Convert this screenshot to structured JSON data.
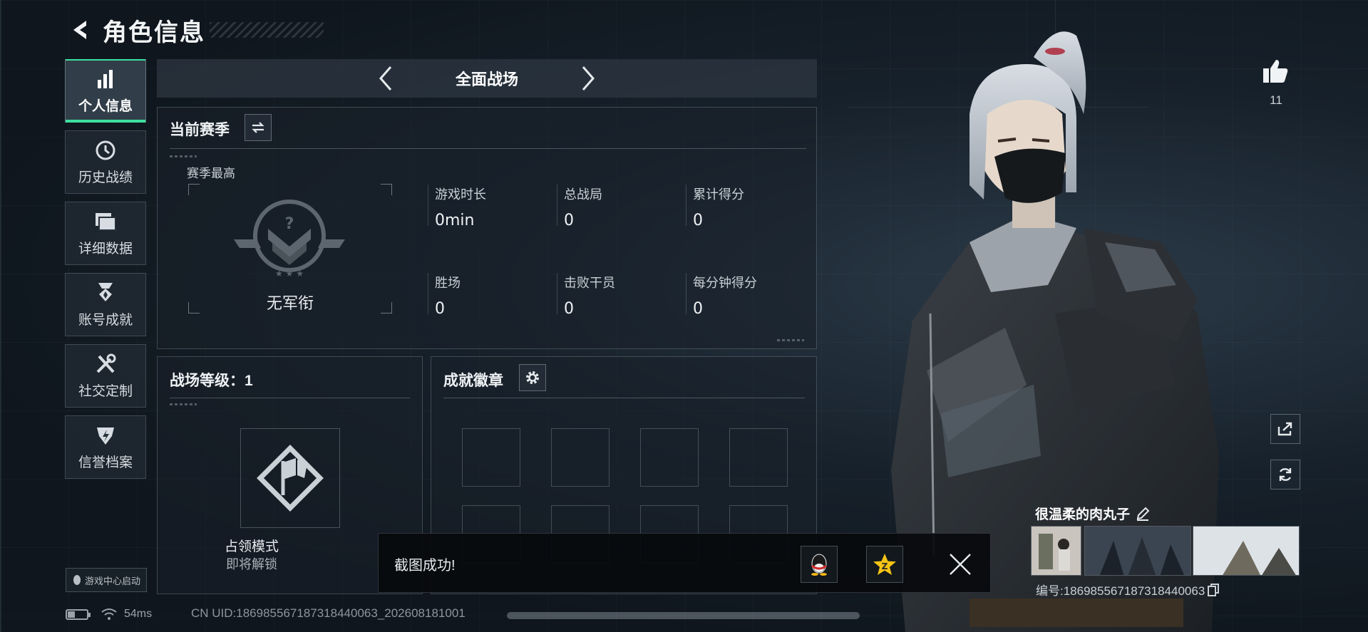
{
  "header": {
    "title": "角色信息"
  },
  "sidebar": {
    "items": [
      {
        "label": "个人信息",
        "icon": "bar-chart-icon"
      },
      {
        "label": "历史战绩",
        "icon": "clock-icon"
      },
      {
        "label": "详细数据",
        "icon": "folder-icon"
      },
      {
        "label": "账号成就",
        "icon": "medal-icon"
      },
      {
        "label": "社交定制",
        "icon": "tools-icon"
      },
      {
        "label": "信誉档案",
        "icon": "shield-icon"
      }
    ],
    "launch_label": "游戏中心启动"
  },
  "mode": {
    "name": "全面战场"
  },
  "season": {
    "title": "当前赛季",
    "sub_title": "赛季最高",
    "rank_name": "无军衔",
    "stats": [
      {
        "label": "游戏时长",
        "value": "0min"
      },
      {
        "label": "总战局",
        "value": "0"
      },
      {
        "label": "累计得分",
        "value": "0"
      },
      {
        "label": "胜场",
        "value": "0"
      },
      {
        "label": "击败干员",
        "value": "0"
      },
      {
        "label": "每分钟得分",
        "value": "0"
      }
    ]
  },
  "level": {
    "title": "战场等级：1",
    "mode_card_title": "占领模式",
    "mode_card_status": "即将解锁"
  },
  "badges": {
    "title": "成就徽章"
  },
  "profile": {
    "likes": "11",
    "nickname": "很温柔的肉丸子",
    "player_id": "编号:186985567187318440063"
  },
  "toast": {
    "message": "截图成功!"
  },
  "status": {
    "ping": "54ms",
    "uid": "CN UID:186985567187318440063_202608181001"
  },
  "colors": {
    "accent": "#3de0a0",
    "panel_border": "#aab9c3"
  }
}
